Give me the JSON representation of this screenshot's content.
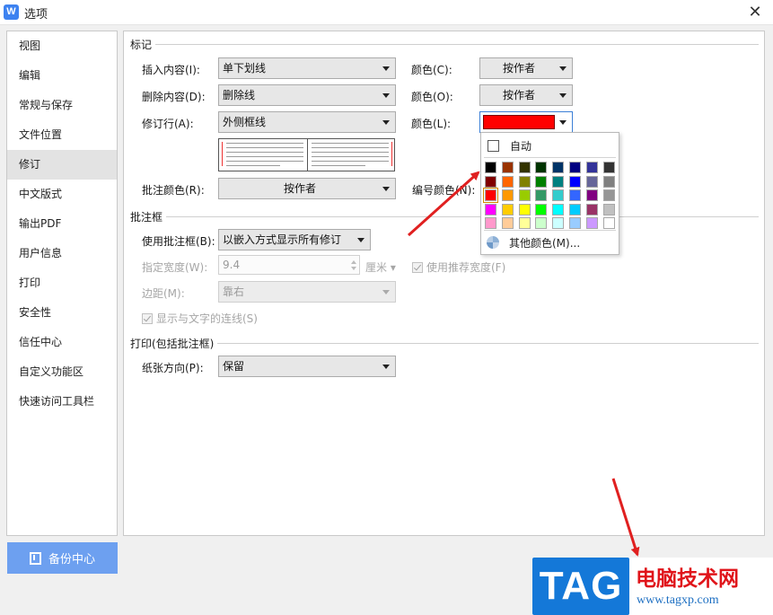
{
  "window": {
    "title": "选项",
    "app_icon": "W",
    "close": "✕"
  },
  "sidebar": {
    "items": [
      "视图",
      "编辑",
      "常规与保存",
      "文件位置",
      "修订",
      "中文版式",
      "输出PDF",
      "用户信息",
      "打印",
      "安全性",
      "信任中心",
      "自定义功能区",
      "快速访问工具栏"
    ],
    "active_index": 4
  },
  "backup": {
    "label": "备份中心"
  },
  "marks": {
    "title": "标记",
    "insert": {
      "label": "插入内容(I):",
      "value": "单下划线",
      "color_label": "颜色(C):",
      "color_value": "按作者"
    },
    "delete": {
      "label": "删除内容(D):",
      "value": "删除线",
      "color_label": "颜色(O):",
      "color_value": "按作者"
    },
    "revline": {
      "label": "修订行(A):",
      "value": "外侧框线",
      "color_label": "颜色(L):",
      "color_hex": "#ff0000"
    },
    "comment_color": {
      "label": "批注颜色(R):",
      "value": "按作者"
    },
    "number_color": {
      "label": "编号颜色(N):"
    }
  },
  "balloon": {
    "title": "批注框",
    "use": {
      "label": "使用批注框(B):",
      "value": "以嵌入方式显示所有修订"
    },
    "width": {
      "label": "指定宽度(W):",
      "value": "9.4",
      "unit": "厘米"
    },
    "recommended": {
      "label": "使用推荐宽度(F)"
    },
    "margin": {
      "label": "边距(M):",
      "value": "靠右"
    },
    "show_lines": {
      "label": "显示与文字的连线(S)"
    }
  },
  "print": {
    "title": "打印(包括批注框)",
    "orientation": {
      "label": "纸张方向(P):",
      "value": "保留"
    }
  },
  "palette": {
    "auto_label": "自动",
    "more_label": "其他颜色(M)...",
    "selected": "#ff0000",
    "colors": [
      [
        "#000000",
        "#993300",
        "#333300",
        "#003300",
        "#003366",
        "#000080",
        "#333399",
        "#333333"
      ],
      [
        "#800000",
        "#ff6600",
        "#808000",
        "#008000",
        "#008080",
        "#0000ff",
        "#666699",
        "#808080"
      ],
      [
        "#ff0000",
        "#ff9900",
        "#99cc00",
        "#339966",
        "#33cccc",
        "#3366ff",
        "#800080",
        "#969696"
      ],
      [
        "#ff00ff",
        "#ffcc00",
        "#ffff00",
        "#00ff00",
        "#00ffff",
        "#00ccff",
        "#993366",
        "#c0c0c0"
      ],
      [
        "#ff99cc",
        "#ffcc99",
        "#ffff99",
        "#ccffcc",
        "#ccffff",
        "#99ccff",
        "#cc99ff",
        "#ffffff"
      ]
    ]
  },
  "watermark": {
    "logo": "TAG",
    "name": "电脑技术网",
    "url": "www.tagxp.com"
  },
  "annotation_color": "#e02020"
}
